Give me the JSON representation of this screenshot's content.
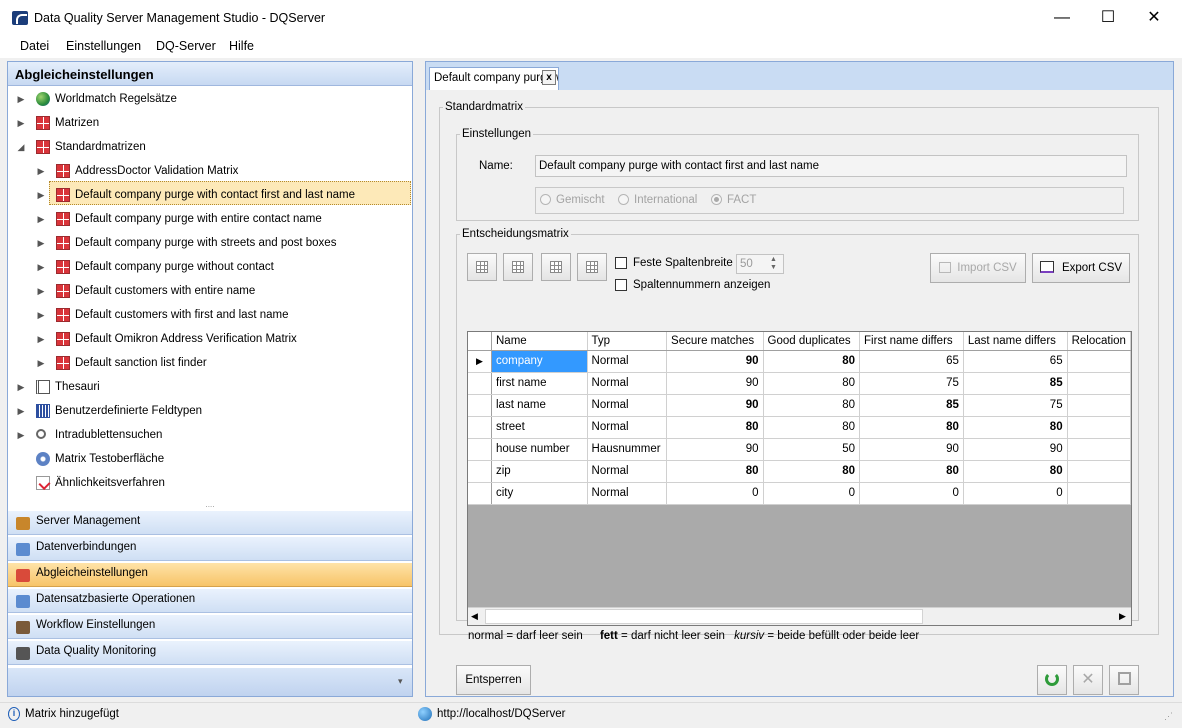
{
  "window": {
    "title": "Data Quality Server Management Studio - DQServer",
    "minimize": "—",
    "maximize": "☐",
    "close": "✕"
  },
  "menu": [
    "Datei",
    "Einstellungen",
    "DQ-Server",
    "Hilfe"
  ],
  "left": {
    "header": "Abgleicheinstellungen",
    "splitter": "....",
    "tree": [
      {
        "label": "Worldmatch Regelsätze",
        "icon": "globe-icon",
        "arrow": "▶",
        "level": 0
      },
      {
        "label": "Matrizen",
        "icon": "matrix-icon",
        "arrow": "▶",
        "level": 0
      },
      {
        "label": "Standardmatrizen",
        "icon": "matrix-icon",
        "arrow": "◢",
        "level": 0
      },
      {
        "label": "AddressDoctor Validation Matrix",
        "icon": "matrix-icon",
        "arrow": "▶",
        "level": 1
      },
      {
        "label": "Default company purge with contact first and last name",
        "icon": "matrix-icon",
        "arrow": "▶",
        "level": 1,
        "selected": true
      },
      {
        "label": "Default company purge with entire contact name",
        "icon": "matrix-icon",
        "arrow": "▶",
        "level": 1
      },
      {
        "label": "Default company purge with streets and post boxes",
        "icon": "matrix-icon",
        "arrow": "▶",
        "level": 1
      },
      {
        "label": "Default company purge without contact",
        "icon": "matrix-icon",
        "arrow": "▶",
        "level": 1
      },
      {
        "label": "Default customers with entire name",
        "icon": "matrix-icon",
        "arrow": "▶",
        "level": 1
      },
      {
        "label": "Default customers with first and last name",
        "icon": "matrix-icon",
        "arrow": "▶",
        "level": 1
      },
      {
        "label": "Default Omikron Address Verification Matrix",
        "icon": "matrix-icon",
        "arrow": "▶",
        "level": 1
      },
      {
        "label": "Default sanction list finder",
        "icon": "matrix-icon",
        "arrow": "▶",
        "level": 1
      },
      {
        "label": "Thesauri",
        "icon": "book-icon",
        "arrow": "▶",
        "level": 0
      },
      {
        "label": "Benutzerdefinierte Feldtypen",
        "icon": "field-types-icon",
        "arrow": "▶",
        "level": 0
      },
      {
        "label": "Intradublettensuchen",
        "icon": "search-icon",
        "arrow": "▶",
        "level": 0
      },
      {
        "label": "Matrix Testoberfläche",
        "icon": "gears-icon",
        "arrow": "",
        "level": 0
      },
      {
        "label": "Ähnlichkeitsverfahren",
        "icon": "checklist-icon",
        "arrow": "",
        "level": 0
      }
    ],
    "nav": [
      {
        "label": "Server Management",
        "icon": "wrench-icon"
      },
      {
        "label": "Datenverbindungen",
        "icon": "database-icon"
      },
      {
        "label": "Abgleicheinstellungen",
        "icon": "matching-icon",
        "active": true
      },
      {
        "label": "Datensatzbasierte Operationen",
        "icon": "records-icon"
      },
      {
        "label": "Workflow Einstellungen",
        "icon": "workflow-icon"
      },
      {
        "label": "Data Quality Monitoring",
        "icon": "monitoring-icon"
      }
    ],
    "nav_footer_arrow": "▾"
  },
  "tab": {
    "label": "Default company purge with contact first and last name",
    "close": "x"
  },
  "standardmatrix": {
    "legend": "Standardmatrix",
    "settings": {
      "legend": "Einstellungen",
      "name_label": "Name:",
      "name_value": "Default company purge with contact first and last name",
      "radios": [
        {
          "label": "Gemischt",
          "checked": false
        },
        {
          "label": "International",
          "checked": false
        },
        {
          "label": "FACT",
          "checked": true
        }
      ]
    },
    "decision": {
      "legend": "Entscheidungsmatrix",
      "fixed_width_label": "Feste Spaltenbreite",
      "fixed_width_value": "50",
      "show_colnums_label": "Spaltennummern anzeigen",
      "import_csv": "Import CSV",
      "export_csv": "Export CSV",
      "columns": [
        "Name",
        "Typ",
        "Secure matches",
        "Good duplicates",
        "First name differs",
        "Last name differs",
        "Relocation"
      ],
      "rows": [
        {
          "name": "company",
          "typ": "Normal",
          "vals": [
            {
              "v": "90",
              "b": true
            },
            {
              "v": "80",
              "b": true
            },
            {
              "v": "65",
              "b": false
            },
            {
              "v": "65",
              "b": false
            }
          ],
          "current": true
        },
        {
          "name": "first name",
          "typ": "Normal",
          "vals": [
            {
              "v": "90",
              "b": false
            },
            {
              "v": "80",
              "b": false
            },
            {
              "v": "75",
              "b": false
            },
            {
              "v": "85",
              "b": true
            }
          ]
        },
        {
          "name": "last name",
          "typ": "Normal",
          "vals": [
            {
              "v": "90",
              "b": true
            },
            {
              "v": "80",
              "b": false
            },
            {
              "v": "85",
              "b": true
            },
            {
              "v": "75",
              "b": false
            }
          ]
        },
        {
          "name": "street",
          "typ": "Normal",
          "vals": [
            {
              "v": "80",
              "b": true
            },
            {
              "v": "80",
              "b": false
            },
            {
              "v": "80",
              "b": true
            },
            {
              "v": "80",
              "b": true
            }
          ]
        },
        {
          "name": "house number",
          "typ": "Hausnummer",
          "vals": [
            {
              "v": "90",
              "b": false
            },
            {
              "v": "50",
              "b": false
            },
            {
              "v": "90",
              "b": false
            },
            {
              "v": "90",
              "b": false
            }
          ]
        },
        {
          "name": "zip",
          "typ": "Normal",
          "vals": [
            {
              "v": "80",
              "b": true
            },
            {
              "v": "80",
              "b": true
            },
            {
              "v": "80",
              "b": true
            },
            {
              "v": "80",
              "b": true
            }
          ]
        },
        {
          "name": "city",
          "typ": "Normal",
          "vals": [
            {
              "v": "0",
              "b": false
            },
            {
              "v": "0",
              "b": false
            },
            {
              "v": "0",
              "b": false
            },
            {
              "v": "0",
              "b": false
            }
          ]
        }
      ],
      "legend_note": {
        "normal": "normal = darf leer sein",
        "bold_word": "fett",
        "bold_rest": " = darf nicht leer sein",
        "italic_word": "kursiv",
        "italic_rest": " = beide befüllt oder beide leer"
      }
    },
    "unlock_button": "Entsperren"
  },
  "status": {
    "left": "Matrix hinzugefügt",
    "url": "http://localhost/DQServer"
  }
}
